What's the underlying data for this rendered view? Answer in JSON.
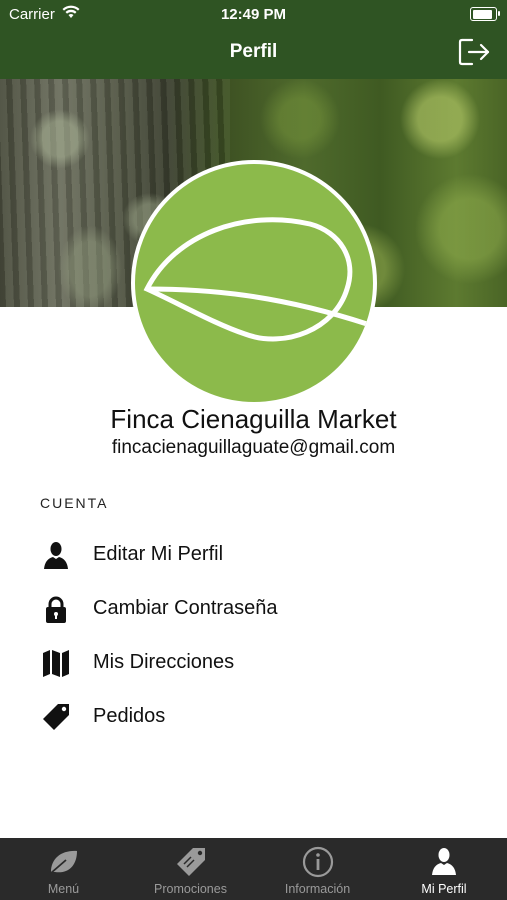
{
  "status_bar": {
    "carrier": "Carrier",
    "time": "12:49 PM"
  },
  "nav": {
    "title": "Perfil",
    "logout_icon": "logout-icon"
  },
  "profile": {
    "name": "Finca Cienaguilla Market",
    "email": "fincacienaguillaguate@gmail.com"
  },
  "section": {
    "title": "CUENTA"
  },
  "menu": [
    {
      "label": "Editar Mi Perfil",
      "icon": "person-icon"
    },
    {
      "label": "Cambiar Contraseña",
      "icon": "lock-icon"
    },
    {
      "label": "Mis Direcciones",
      "icon": "map-icon"
    },
    {
      "label": "Pedidos",
      "icon": "tag-icon"
    }
  ],
  "tabs": [
    {
      "label": "Menú",
      "icon": "leaf-icon",
      "active": false
    },
    {
      "label": "Promociones",
      "icon": "tags-icon",
      "active": false
    },
    {
      "label": "Información",
      "icon": "info-icon",
      "active": false
    },
    {
      "label": "Mi Perfil",
      "icon": "person-icon",
      "active": true
    }
  ],
  "colors": {
    "nav_bg": "#2f5423",
    "avatar_bg": "#8cba4b",
    "tabbar_bg": "#2a2a2a"
  }
}
